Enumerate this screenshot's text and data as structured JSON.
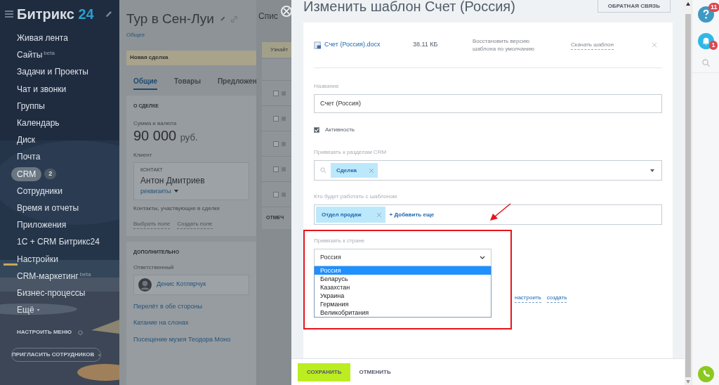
{
  "sidebar": {
    "logo_name": "Битрикс",
    "logo_number": "24",
    "items": [
      {
        "label": "Живая лента",
        "selected": false
      },
      {
        "label": "Сайты",
        "sup": "beta",
        "selected": false
      },
      {
        "label": "Задачи и Проекты",
        "selected": false
      },
      {
        "label": "Чат и звонки",
        "selected": false
      },
      {
        "label": "Группы",
        "selected": false
      },
      {
        "label": "Календарь",
        "selected": false
      },
      {
        "label": "Диск",
        "selected": false
      },
      {
        "label": "Почта",
        "selected": false
      },
      {
        "label": "CRM",
        "badge": "2",
        "selected": true
      },
      {
        "label": "Сотрудники",
        "selected": false
      },
      {
        "label": "Время и отчеты",
        "selected": false
      },
      {
        "label": "Приложения",
        "selected": false
      },
      {
        "label": "1С + CRM Битрикс24",
        "selected": false
      },
      {
        "label": "Настройки",
        "selected": false
      },
      {
        "label": "CRM-маркетинг",
        "sup": "beta",
        "selected": false
      },
      {
        "label": "Бизнес-процессы",
        "selected": false
      },
      {
        "label": "Ещё",
        "kind": "more",
        "selected": false
      }
    ],
    "settings": "НАСТРОИТЬ МЕНЮ",
    "invite": "ПРИГЛАСИТЬ СОТРУДНИКОВ"
  },
  "deal": {
    "title": "Тур в Сен-Луи",
    "breadcrumb": "Общее",
    "stage": "Новая сделка",
    "tabs": [
      {
        "label": "Общие",
        "selected": true
      },
      {
        "label": "Товары",
        "selected": false
      },
      {
        "label": "Предложен",
        "selected": false
      }
    ],
    "about": {
      "heading": "О СДЕЛКЕ",
      "amount_label": "Сумма и валюта",
      "amount": "90 000",
      "currency": "руб.",
      "client_label": "Клиент",
      "contact_caption": "КОНТАКТ",
      "contact_name": "Антон Дмитриев",
      "requisites": "реквизиты",
      "participants": "Контакты, участвующие в сделке",
      "links": [
        "Выбрать поле",
        "Создать поле"
      ]
    },
    "extra": {
      "heading": "ДОПОЛНИТЕЛЬНО",
      "responsible_label": "Ответственный",
      "responsible_name": "Денис Котлярчук",
      "items": [
        "Перелёт в обе стороны",
        "Катание на слонах",
        "Посещение музея Теодора Моно"
      ]
    }
  },
  "list_panel": {
    "title": "Спис",
    "banner": "Узнайт",
    "rows": [
      {
        "checked": false
      },
      {
        "checked": false
      },
      {
        "checked": false
      },
      {
        "checked": false
      },
      {
        "checked": false
      }
    ],
    "footer": "ОТМЕЧ"
  },
  "editor": {
    "title": "Изменить шаблон Счет (Россия)",
    "feedback": "ОБРАТНАЯ СВЯЗЬ",
    "file": {
      "name": "Счет (Россия).docx",
      "size": "38.11 КБ",
      "restore": "Восстановить версию шаблона по умолчанию",
      "download": "Скачать шаблон"
    },
    "name_label": "Название",
    "name_value": "Счет (Россия)",
    "active": {
      "label": "Активность",
      "checked": true
    },
    "crm": {
      "label": "Привязать к разделам CRM",
      "tags": [
        "Сделка"
      ]
    },
    "workers": {
      "label": "Кто будет работать с шаблоном",
      "tags": [
        "Отдел продаж"
      ],
      "add": "+ Добавить еще"
    },
    "country": {
      "label": "Привязать к стране",
      "value": "Россия",
      "options": [
        {
          "label": "Россия",
          "selected": true
        },
        {
          "label": "Беларусь",
          "selected": false
        },
        {
          "label": "Казахстан",
          "selected": false
        },
        {
          "label": "Украина",
          "selected": false
        },
        {
          "label": "Германия",
          "selected": false
        },
        {
          "label": "Великобритания",
          "selected": false
        }
      ]
    },
    "links": [
      "настроить",
      "создать"
    ],
    "save": "СОХРАНИТЬ",
    "cancel": "ОТМЕНИТЬ"
  },
  "rail": {
    "help_badge": "11",
    "bell_badge": "1"
  }
}
